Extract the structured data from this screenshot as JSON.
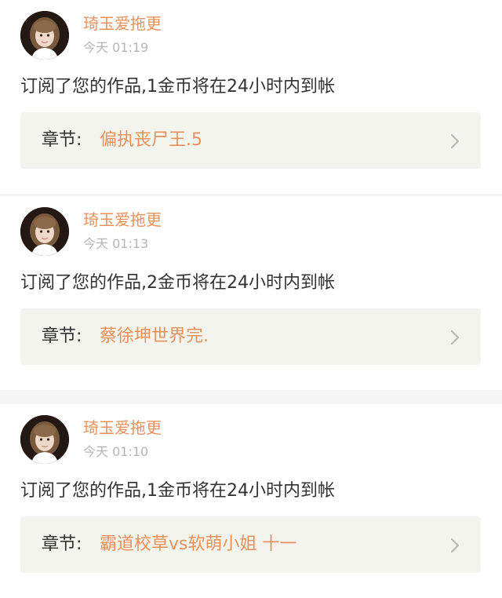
{
  "notifications": [
    {
      "username": "琦玉爱拖更",
      "time": "今天 01:19",
      "message": "订阅了您的作品,1金币将在24小时内到帐",
      "chapter_prefix": "章节:",
      "chapter_title": "偏执丧尸王.5"
    },
    {
      "username": "琦玉爱拖更",
      "time": "今天 01:13",
      "message": "订阅了您的作品,2金币将在24小时内到帐",
      "chapter_prefix": "章节:",
      "chapter_title": "蔡徐坤世界完."
    },
    {
      "username": "琦玉爱拖更",
      "time": "今天 01:10",
      "message": "订阅了您的作品,1金币将在24小时内到帐",
      "chapter_prefix": "章节:",
      "chapter_title": "霸道校草vs软萌小姐 十一"
    }
  ],
  "colors": {
    "accent": "#e8915a",
    "text": "#333333",
    "muted": "#b5b5b5",
    "chapter_bg": "#f4f4ef",
    "separator": "#f5f5f5"
  },
  "icons": {
    "avatar": "girl-portrait-avatar",
    "chevron": "chevron-right-icon"
  }
}
